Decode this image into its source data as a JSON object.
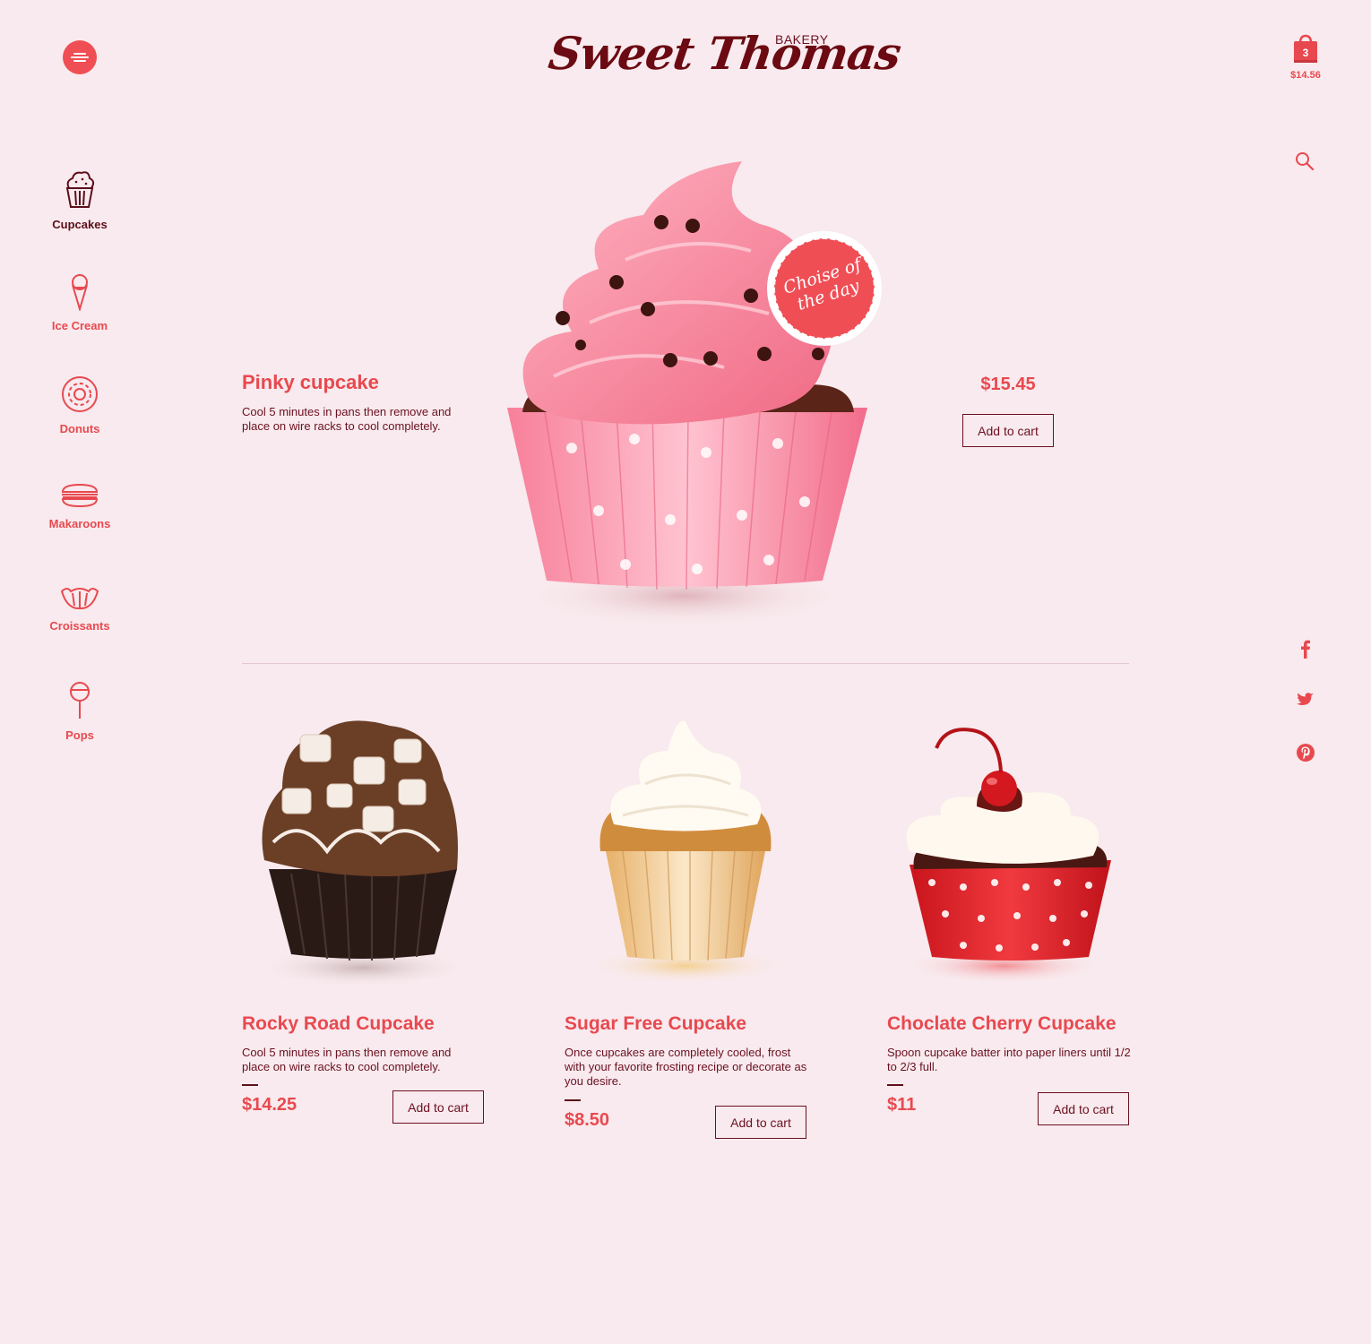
{
  "header": {
    "logo": "Sweet Thomas",
    "logo_sub": "BAKERY",
    "cart_count": "3",
    "cart_total": "$14.56"
  },
  "categories": [
    {
      "label": "Cupcakes",
      "icon": "cupcake-icon",
      "active": true
    },
    {
      "label": "Ice Cream",
      "icon": "ice-cream-icon",
      "active": false
    },
    {
      "label": "Donuts",
      "icon": "donut-icon",
      "active": false
    },
    {
      "label": "Makaroons",
      "icon": "macaron-icon",
      "active": false
    },
    {
      "label": "Croissants",
      "icon": "croissant-icon",
      "active": false
    },
    {
      "label": "Pops",
      "icon": "lollipop-icon",
      "active": false
    }
  ],
  "hero": {
    "title": "Pinky cupcake",
    "description": "Cool 5 minutes in pans then remove and place on wire racks to cool completely.",
    "price": "$15.45",
    "button": "Add to cart",
    "badge": "Choise of the day"
  },
  "products": [
    {
      "title": "Rocky Road Cupcake",
      "description": "Cool 5 minutes in pans then remove and place on wire racks to cool completely.",
      "price": "$14.25",
      "button": "Add to cart"
    },
    {
      "title": "Sugar Free Cupcake",
      "description": "Once cupcakes are completely cooled, frost with your favorite frosting recipe or decorate as you desire.",
      "price": "$8.50",
      "button": "Add to cart"
    },
    {
      "title": "Choclate Cherry Cupcake",
      "description": "Spoon cupcake batter into paper liners until 1/2 to 2/3 full.",
      "price": "$11",
      "button": "Add to cart"
    }
  ],
  "colors": {
    "background": "#f8eaee",
    "accent": "#e8494f",
    "dark": "#6b1020"
  }
}
